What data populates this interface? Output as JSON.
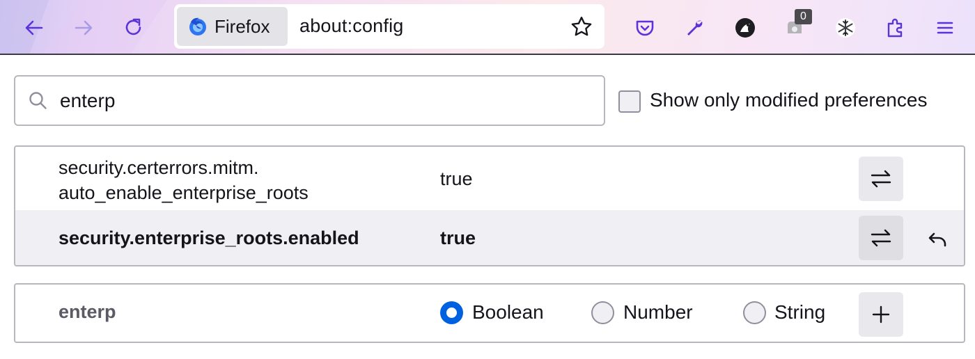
{
  "toolbar": {
    "back_icon": "back-arrow-icon",
    "forward_icon": "forward-arrow-icon",
    "reload_icon": "reload-icon",
    "identity_label": "Firefox",
    "url": "about:config",
    "bookmark_icon": "star-icon",
    "extensions": [
      {
        "icon": "pocket-icon"
      },
      {
        "icon": "wrench-icon"
      },
      {
        "icon": "avatar-extension-icon"
      },
      {
        "icon": "blocker-extension-icon",
        "badge": "0"
      },
      {
        "icon": "snowflake-icon"
      },
      {
        "icon": "puzzle-icon"
      },
      {
        "icon": "hamburger-menu-icon"
      }
    ],
    "accent_color": "#5b34d9"
  },
  "search": {
    "value": "enterp",
    "modified_only_label": "Show only modified preferences",
    "modified_only_checked": false
  },
  "prefs": [
    {
      "name_line1": "security.certerrors.mitm.",
      "name_line2": "auto_enable_enterprise_roots",
      "value": "true",
      "modified": false
    },
    {
      "name": "security.enterprise_roots.enabled",
      "value": "true",
      "modified": true
    }
  ],
  "new_pref": {
    "name": "enterp",
    "types": [
      {
        "label": "Boolean",
        "checked": true
      },
      {
        "label": "Number",
        "checked": false
      },
      {
        "label": "String",
        "checked": false
      }
    ]
  },
  "colors": {
    "radio_checked": "#0061e0",
    "modified_row_bg": "#f0f0f4"
  }
}
